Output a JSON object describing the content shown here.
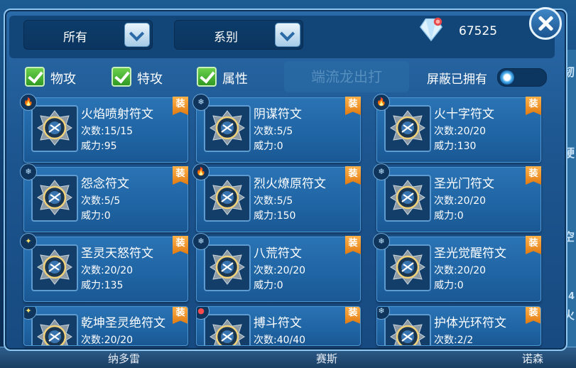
{
  "filters": {
    "dropdown_all": "所有",
    "dropdown_series": "系别"
  },
  "currency": {
    "value": "67525",
    "icon": "gem-icon"
  },
  "checkboxes": [
    {
      "label": "物攻",
      "checked": true
    },
    {
      "label": "特攻",
      "checked": true
    },
    {
      "label": "属性",
      "checked": true
    }
  ],
  "hide_owned": {
    "label": "屏蔽已拥有",
    "on": false
  },
  "background_text": {
    "ghost": "端流龙出打",
    "right_chars": [
      "韧",
      "硬",
      "空",
      "24",
      "火"
    ],
    "bottom_labels": [
      "纳多雷",
      "赛斯",
      "诺森"
    ]
  },
  "equip_badge": "装",
  "runes": [
    {
      "name": "火焰喷射符文",
      "times": "次数:15/15",
      "power": "威力:95",
      "element": "fire",
      "color": "#ffffff"
    },
    {
      "name": "阴谋符文",
      "times": "次数:5/5",
      "power": "威力:0",
      "element": "ice",
      "color": "#ffffff"
    },
    {
      "name": "火十字符文",
      "times": "次数:20/20",
      "power": "威力:130",
      "element": "fire",
      "color": "#ffffff"
    },
    {
      "name": "怨念符文",
      "times": "次数:5/5",
      "power": "威力:0",
      "element": "ice",
      "color": "#ffffff"
    },
    {
      "name": "烈火燎原符文",
      "times": "次数:5/5",
      "power": "威力:150",
      "element": "fire",
      "color": "#ffffff"
    },
    {
      "name": "圣光门符文",
      "times": "次数:20/20",
      "power": "威力:0",
      "element": "ice",
      "color": "#ffffff"
    },
    {
      "name": "圣灵天怒符文",
      "times": "次数:20/20",
      "power": "威力:135",
      "element": "holy",
      "color": "#ffffff"
    },
    {
      "name": "八荒符文",
      "times": "次数:20/20",
      "power": "威力:0",
      "element": "ice",
      "color": "#ffffff"
    },
    {
      "name": "圣光觉醒符文",
      "times": "次数:20/20",
      "power": "威力:0",
      "element": "ice",
      "color": "#ffffff"
    },
    {
      "name": "乾坤圣灵绝符文",
      "times": "次数:20/20",
      "power": "",
      "element": "holy",
      "color": "#ffffff"
    },
    {
      "name": "搏斗符文",
      "times": "次数:40/40",
      "power": "",
      "element": "fight",
      "color": "#ffffff"
    },
    {
      "name": "护体光环符文",
      "times": "次数:2/2",
      "power": "",
      "element": "ice",
      "color": "#ffffff"
    }
  ]
}
